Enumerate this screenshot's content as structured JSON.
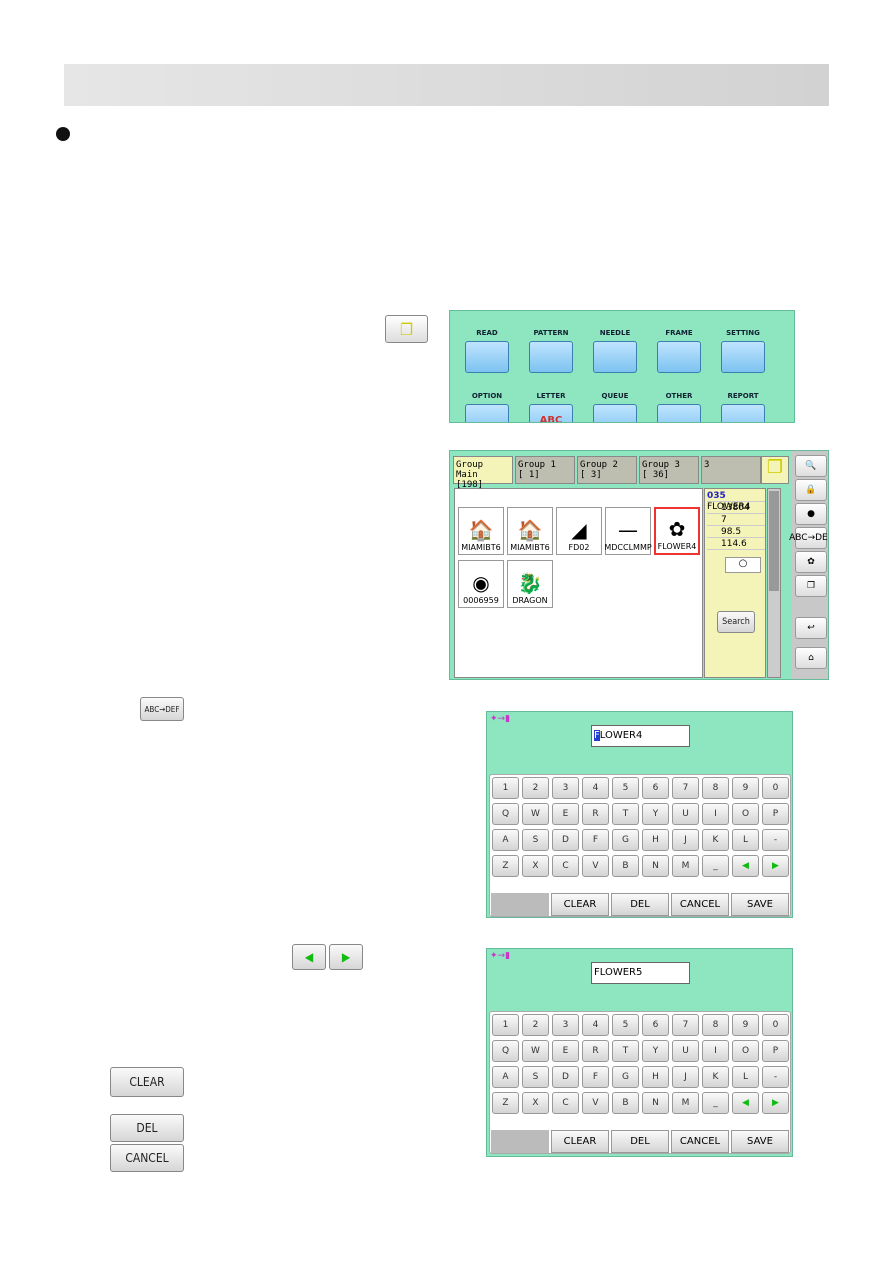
{
  "menu_screen": {
    "items": [
      {
        "label": "READ",
        "icon": "read-icon"
      },
      {
        "label": "PATTERN",
        "icon": "pattern-icon"
      },
      {
        "label": "NEEDLE",
        "icon": "needle-icon"
      },
      {
        "label": "FRAME",
        "icon": "frame-icon"
      },
      {
        "label": "SETTING",
        "icon": "setting-icon"
      },
      {
        "label": "OPTION",
        "icon": "option-icon"
      },
      {
        "label": "LETTER",
        "icon": "letter-icon",
        "glyph": "ABC"
      },
      {
        "label": "QUEUE",
        "icon": "queue-icon"
      },
      {
        "label": "OTHER",
        "icon": "other-icon"
      },
      {
        "label": "REPORT",
        "icon": "report-icon"
      }
    ]
  },
  "group_screen": {
    "tabs": [
      {
        "label": "Group Main",
        "count": "[198]"
      },
      {
        "label": "Group 1",
        "count": "[  1]"
      },
      {
        "label": "Group 2",
        "count": "[  3]"
      },
      {
        "label": "Group 3",
        "count": "[ 36]"
      },
      {
        "label": "",
        "count": "3"
      }
    ],
    "designs": [
      {
        "name": "MIAMIBT6",
        "selected": false
      },
      {
        "name": "MIAMIBT6",
        "selected": false
      },
      {
        "name": "FD02",
        "selected": false
      },
      {
        "name": "MDCCLMMP",
        "selected": false
      },
      {
        "name": "FLOWER4",
        "selected": true
      },
      {
        "name": "0006959",
        "selected": false
      },
      {
        "name": "DRAGON",
        "selected": false
      }
    ],
    "info": {
      "number": "035",
      "name": "FLOWER4",
      "stitches": "13804",
      "colors": "7",
      "height": "98.5",
      "width": "114.6"
    },
    "search_label": "Search",
    "side_buttons": [
      "search-icon",
      "lock-icon",
      "dot-icon",
      "rename-icon",
      "flower-icon",
      "copy-icon",
      "return-icon",
      "home-icon"
    ],
    "rename_label": "ABC→DEF"
  },
  "keyboard": {
    "rows": [
      [
        "1",
        "2",
        "3",
        "4",
        "5",
        "6",
        "7",
        "8",
        "9",
        "0"
      ],
      [
        "Q",
        "W",
        "E",
        "R",
        "T",
        "Y",
        "U",
        "I",
        "O",
        "P"
      ],
      [
        "A",
        "S",
        "D",
        "F",
        "G",
        "H",
        "J",
        "K",
        "L",
        "-"
      ],
      [
        "Z",
        "X",
        "C",
        "V",
        "B",
        "N",
        "M",
        "_",
        "◀",
        "▶"
      ]
    ],
    "buttons": [
      "CLEAR",
      "DEL",
      "CANCEL",
      "SAVE"
    ]
  },
  "keyboard1": {
    "value_cursor": "F",
    "value_rest": "LOWER4"
  },
  "keyboard2": {
    "value_rest": "FLOWER5",
    "value_cursor": " "
  },
  "inline": {
    "rename_label": "ABC→DEF",
    "left_arrow": "◀",
    "right_arrow": "▶",
    "clear": "CLEAR",
    "del": "DEL",
    "cancel": "CANCEL"
  },
  "colors": {
    "screen_bg": "#8de6c0",
    "panel_yellow": "#f4f3b8",
    "cursor": "#2040d0",
    "selected_border": "#ee3333"
  }
}
